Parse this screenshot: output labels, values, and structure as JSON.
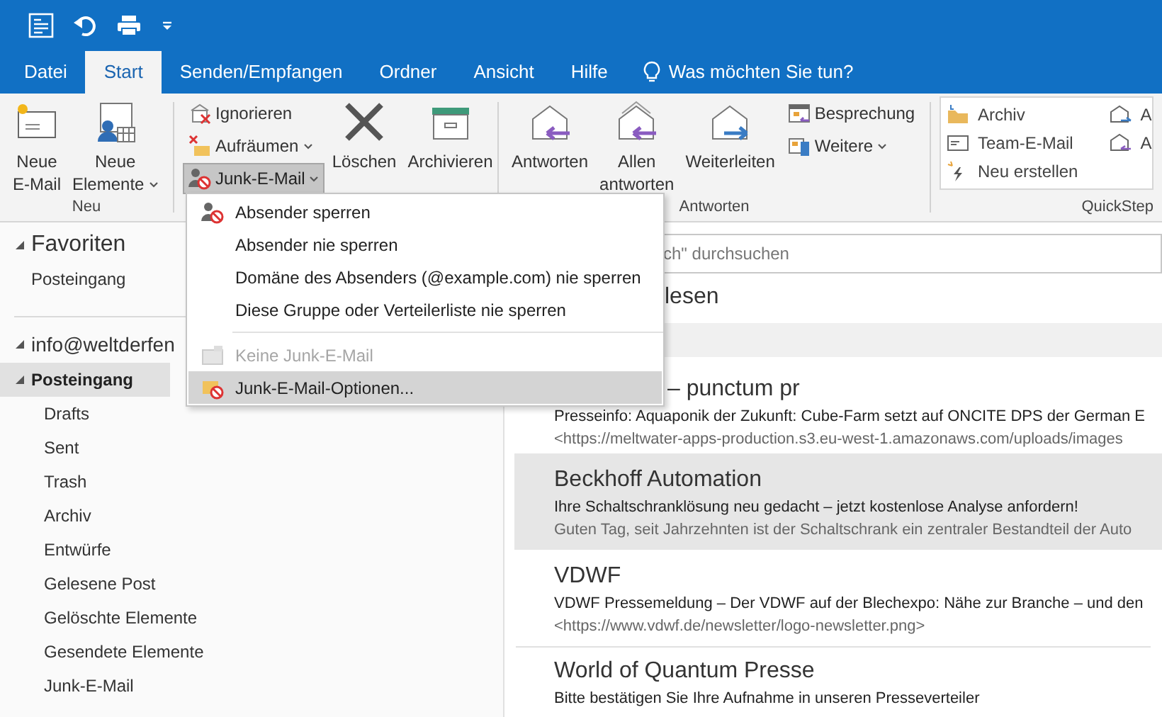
{
  "tabs": [
    {
      "label": "Datei",
      "selected": false
    },
    {
      "label": "Start",
      "selected": true
    },
    {
      "label": "Senden/Empfangen",
      "selected": false
    },
    {
      "label": "Ordner",
      "selected": false
    },
    {
      "label": "Ansicht",
      "selected": false
    },
    {
      "label": "Hilfe",
      "selected": false
    }
  ],
  "tell_me": "Was möchten Sie tun?",
  "ribbon": [
    {
      "label": "Neu",
      "items": [
        {
          "kind": "large",
          "lines": [
            "Neue",
            "E-Mail"
          ],
          "dropdown": false
        },
        {
          "kind": "large",
          "lines": [
            "Neue",
            "Elemente"
          ],
          "dropdown": true
        }
      ]
    },
    {
      "items": [
        {
          "kind": "stack",
          "items": [
            {
              "label": "Ignorieren",
              "dropdown": false,
              "pressed": false
            },
            {
              "label": "Aufräumen",
              "dropdown": true,
              "pressed": false
            },
            {
              "label": "Junk-E-Mail",
              "dropdown": true,
              "pressed": true
            }
          ]
        },
        {
          "kind": "large",
          "lines": [
            "Löschen"
          ],
          "dropdown": false
        },
        {
          "kind": "large",
          "lines": [
            "Archivieren"
          ],
          "dropdown": false
        }
      ]
    },
    {
      "label": "Antworten",
      "items": [
        {
          "kind": "large",
          "lines": [
            "Antworten"
          ],
          "dropdown": false
        },
        {
          "kind": "large",
          "lines": [
            "Allen",
            "antworten"
          ],
          "dropdown": false
        },
        {
          "kind": "large",
          "lines": [
            "Weiterleiten"
          ],
          "dropdown": false
        },
        {
          "kind": "stack",
          "items": [
            {
              "label": "Besprechung",
              "dropdown": false,
              "pressed": false
            },
            {
              "label": "Weitere",
              "dropdown": true,
              "pressed": false
            }
          ]
        }
      ]
    },
    {
      "label": "QuickStep",
      "items": [
        {
          "kind": "gallery",
          "columns": [
            [
              "Archiv",
              "Team-E-Mail",
              "Neu erstellen"
            ],
            [
              "A",
              "A"
            ]
          ]
        }
      ]
    }
  ],
  "junk_menu": [
    [
      {
        "label": "Absender sperren",
        "disabled": false,
        "selected": false
      },
      {
        "label": "Absender nie sperren",
        "disabled": false,
        "selected": false
      },
      {
        "label": "Domäne des Absenders (@example.com) nie sperren",
        "disabled": false,
        "selected": false
      },
      {
        "label": "Diese Gruppe oder Verteilerliste nie sperren",
        "disabled": false,
        "selected": false
      }
    ],
    [
      {
        "label": "Keine Junk-E-Mail",
        "disabled": true,
        "selected": false
      },
      {
        "label": "Junk-E-Mail-Optionen...",
        "disabled": false,
        "selected": true
      }
    ]
  ],
  "folder_pane": {
    "favorites": {
      "label": "Favoriten",
      "expanded": true,
      "items": [
        {
          "label": "Posteingang",
          "selected": false
        }
      ]
    },
    "account": {
      "label": "info@weltderfen",
      "expanded": true,
      "folders": [
        {
          "label": "Posteingang",
          "expanded": true,
          "selected": true,
          "children": [
            {
              "label": "Drafts",
              "selected": false
            },
            {
              "label": "Sent",
              "selected": false
            },
            {
              "label": "Trash",
              "selected": false
            },
            {
              "label": "Archiv",
              "selected": false
            },
            {
              "label": "Entwürfe",
              "selected": false
            },
            {
              "label": "Gelesene Post",
              "selected": false
            },
            {
              "label": "Gelöschte Elemente",
              "selected": false
            },
            {
              "label": "Gesendete Elemente",
              "selected": false
            },
            {
              "label": "Junk-E-Mail",
              "selected": false
            }
          ]
        }
      ]
    }
  },
  "message_list": {
    "search": {
      "placeholder": "ch\" durchsuchen"
    },
    "heading": "lesen",
    "messages": [
      {
        "sender": "– punctum pr",
        "subject": "Presseinfo: Aquaponik der Zukunft: Cube-Farm setzt auf ONCITE DPS der German E",
        "preview": "<https://meltwater-apps-production.s3.eu-west-1.amazonaws.com/uploads/images",
        "selected": false
      },
      {
        "sender": "Beckhoff Automation",
        "subject": "Ihre Schaltschranklösung neu gedacht – jetzt kostenlose Analyse anfordern!",
        "preview": "Guten Tag, seit Jahrzehnten ist der Schaltschrank ein zentraler Bestandteil der Auto",
        "selected": true
      },
      {
        "sender": "VDWF",
        "subject": "VDWF Pressemeldung – Der VDWF auf der Blechexpo: Nähe zur Branche – und den",
        "preview": "<https://www.vdwf.de/newsletter/logo-newsletter.png>",
        "selected": false
      },
      {
        "sender": "World of Quantum Presse",
        "subject": "Bitte bestätigen Sie Ihre Aufnahme in unseren Presseverteiler",
        "selected": false
      }
    ]
  }
}
